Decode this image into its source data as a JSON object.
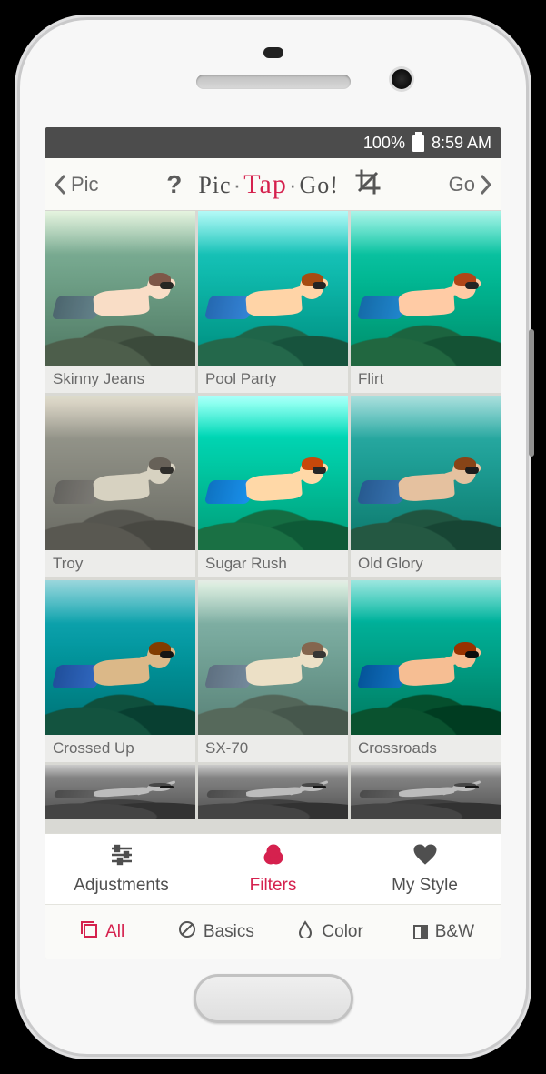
{
  "status": {
    "battery_pct": "100%",
    "time": "8:59 AM"
  },
  "topbar": {
    "back_label": "Pic",
    "forward_label": "Go",
    "help_label": "?",
    "logo_pic": "Pic",
    "logo_tap": "Tap",
    "logo_go": "Go!",
    "crop_name": "crop-icon"
  },
  "filters": [
    {
      "label": "Skinny Jeans",
      "cls": "f-skinny"
    },
    {
      "label": "Pool Party",
      "cls": "f-pool"
    },
    {
      "label": "Flirt",
      "cls": "f-flirt"
    },
    {
      "label": "Troy",
      "cls": "f-troy"
    },
    {
      "label": "Sugar Rush",
      "cls": "f-sugar"
    },
    {
      "label": "Old Glory",
      "cls": "f-glory"
    },
    {
      "label": "Crossed Up",
      "cls": "f-crossed"
    },
    {
      "label": "SX-70",
      "cls": "f-sx70"
    },
    {
      "label": "Crossroads",
      "cls": "f-cross"
    }
  ],
  "partial_row_cls": "f-bw",
  "tabs_primary": [
    {
      "label": "Adjustments",
      "icon": "sliders-icon",
      "active": false
    },
    {
      "label": "Filters",
      "icon": "filters-icon",
      "active": true
    },
    {
      "label": "My Style",
      "icon": "heart-icon",
      "active": false
    }
  ],
  "tabs_secondary": [
    {
      "label": "All",
      "icon": "stack-icon",
      "active": true
    },
    {
      "label": "Basics",
      "icon": "ban-icon",
      "active": false
    },
    {
      "label": "Color",
      "icon": "droplet-icon",
      "active": false
    },
    {
      "label": "B&W",
      "icon": "halfbox-icon",
      "active": false
    }
  ],
  "accent": "#d5214e"
}
